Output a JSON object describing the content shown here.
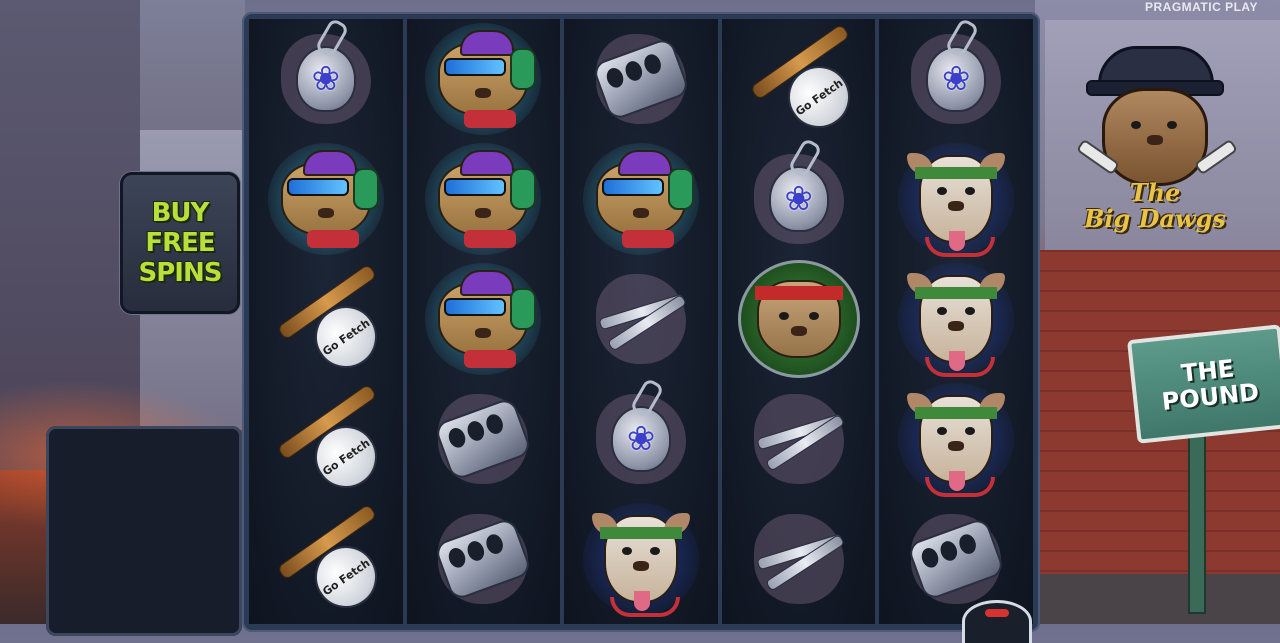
{
  "provider": "PRAGMATIC PLAY",
  "logo": {
    "title_line1": "The",
    "title_line2": "Big Dawgs"
  },
  "buy_feature": {
    "line1": "BUY",
    "line2": "FREE",
    "line3": "SPINS"
  },
  "sign": {
    "line1": "THE",
    "line2": "POUND"
  },
  "ball_text": "Go Fetch",
  "grid": {
    "columns": 5,
    "rows": 5,
    "reels": [
      [
        "paw-pendant",
        "hiphop-dog",
        "bat-ball",
        "bat-ball",
        "bat-ball"
      ],
      [
        "hiphop-dog",
        "hiphop-dog",
        "hiphop-dog",
        "brass-knuckles",
        "brass-knuckles"
      ],
      [
        "brass-knuckles",
        "hiphop-dog",
        "scissors",
        "paw-pendant",
        "pitbull-dog"
      ],
      [
        "bat-ball",
        "paw-pendant",
        "bulldog",
        "scissors",
        "scissors"
      ],
      [
        "paw-pendant",
        "pitbull-dog",
        "pitbull-dog",
        "pitbull-dog",
        "brass-knuckles"
      ]
    ]
  }
}
